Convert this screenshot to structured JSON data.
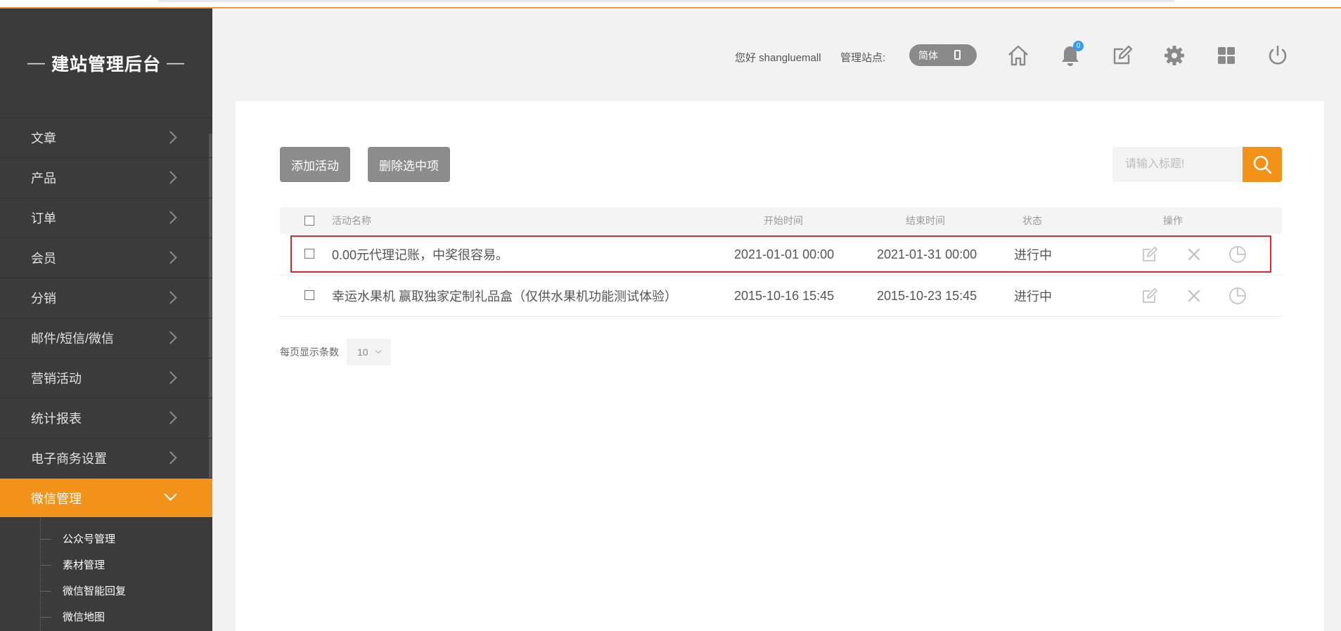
{
  "sidebar": {
    "brand": "建站管理后台",
    "brand_dash": "—",
    "items": [
      {
        "label": "文章"
      },
      {
        "label": "产品"
      },
      {
        "label": "订单"
      },
      {
        "label": "会员"
      },
      {
        "label": "分销"
      },
      {
        "label": "邮件/短信/微信"
      },
      {
        "label": "营销活动"
      },
      {
        "label": "统计报表"
      },
      {
        "label": "电子商务设置"
      },
      {
        "label": "微信管理"
      }
    ],
    "active": "微信管理",
    "subitems": [
      {
        "label": "公众号管理"
      },
      {
        "label": "素材管理"
      },
      {
        "label": "微信智能回复"
      },
      {
        "label": "微信地图"
      }
    ]
  },
  "header": {
    "greeting": "您好 shangluemall",
    "site_label": "管理站点:",
    "lang_toggle": "简体",
    "notification_count": "0",
    "icons": [
      "home-icon",
      "bell-icon",
      "edit-icon",
      "gear-icon",
      "grid-icon",
      "power-icon"
    ]
  },
  "toolbar": {
    "add_label": "添加活动",
    "delete_label": "删除选中项",
    "search_placeholder": "请输入标题!"
  },
  "table": {
    "columns": {
      "name": "活动名称",
      "start": "开始时间",
      "end": "结束时间",
      "status": "状态",
      "ops": "操作"
    },
    "rows": [
      {
        "name": "0.00元代理记账，中奖很容易。",
        "start": "2021-01-01 00:00",
        "end": "2021-01-31 00:00",
        "status": "进行中",
        "highlighted": true
      },
      {
        "name": "幸运水果机 赢取独家定制礼品盒（仅供水果机功能测试体验）",
        "start": "2015-10-16 15:45",
        "end": "2015-10-23 15:45",
        "status": "进行中",
        "highlighted": false
      }
    ]
  },
  "pager": {
    "label": "每页显示条数",
    "per_page": "10"
  },
  "colors": {
    "accent": "#f39219",
    "sidebar_bg": "#3b3b3b",
    "highlight_border": "#e0272b",
    "badge": "#3a9ae6"
  }
}
